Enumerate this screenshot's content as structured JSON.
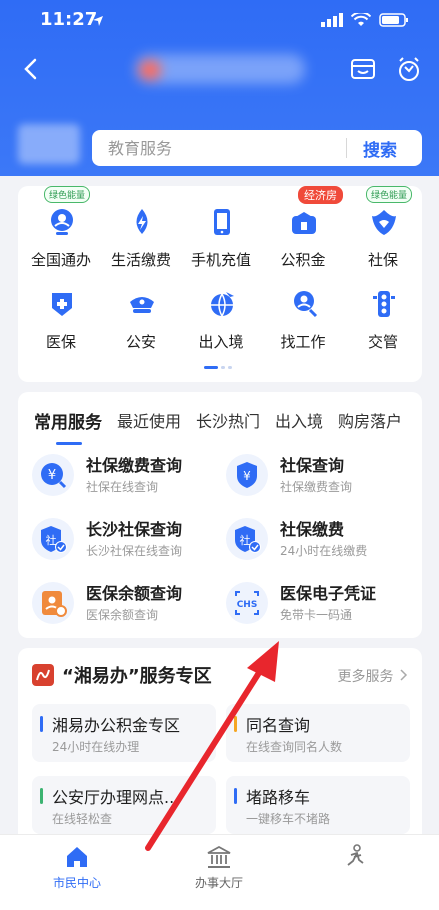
{
  "status_bar": {
    "time": "11:27"
  },
  "search": {
    "placeholder": "教育服务",
    "button_label": "搜索"
  },
  "quick_grid": {
    "items": [
      {
        "label": "全国通办",
        "badge": "绿色能量",
        "badge_type": "green",
        "icon": "globe-service-icon"
      },
      {
        "label": "生活缴费",
        "badge": "",
        "icon": "utility-bolt-icon"
      },
      {
        "label": "手机充值",
        "badge": "",
        "icon": "phone-icon"
      },
      {
        "label": "公积金",
        "badge": "经济房",
        "badge_type": "red",
        "icon": "housing-fund-icon"
      },
      {
        "label": "社保",
        "badge": "绿色能量",
        "badge_type": "green",
        "icon": "social-security-icon"
      },
      {
        "label": "医保",
        "badge": "",
        "icon": "medical-insurance-icon"
      },
      {
        "label": "公安",
        "badge": "",
        "icon": "police-cap-icon"
      },
      {
        "label": "出入境",
        "badge": "",
        "icon": "airplane-globe-icon"
      },
      {
        "label": "找工作",
        "badge": "",
        "icon": "job-search-icon"
      },
      {
        "label": "交管",
        "badge": "",
        "icon": "traffic-light-icon"
      }
    ]
  },
  "services": {
    "tabs": [
      "常用服务",
      "最近使用",
      "长沙热门",
      "出入境",
      "购房落户"
    ],
    "active_tab": 0,
    "items": [
      {
        "title": "社保缴费查询",
        "subtitle": "社保在线查询",
        "icon": "yuan-search-icon"
      },
      {
        "title": "社保查询",
        "subtitle": "社保缴费查询",
        "icon": "yuan-shield-icon"
      },
      {
        "title": "长沙社保查询",
        "subtitle": "长沙社保在线查询",
        "icon": "shield-check-icon"
      },
      {
        "title": "社保缴费",
        "subtitle": "24小时在线缴费",
        "icon": "shield-check-icon"
      },
      {
        "title": "医保余额查询",
        "subtitle": "医保余额查询",
        "icon": "medical-balance-icon"
      },
      {
        "title": "医保电子凭证",
        "subtitle": "免带卡一码通",
        "icon": "chs-code-icon"
      }
    ]
  },
  "zone": {
    "title": "“湘易办”服务专区",
    "more_label": "更多服务",
    "tiles": [
      {
        "title": "湘易办公积金专区",
        "subtitle": "24小时在线办理",
        "accent": "#2f6cf5"
      },
      {
        "title": "同名查询",
        "subtitle": "在线查询同名人数",
        "accent": "#f5a623"
      },
      {
        "title": "公安厅办理网点...",
        "subtitle": "在线轻松查",
        "accent": "#3cb371"
      },
      {
        "title": "堵路移车",
        "subtitle": "一键移车不堵路",
        "accent": "#2f6cf5"
      }
    ]
  },
  "bottom_nav": {
    "items": [
      {
        "label": "市民中心",
        "icon": "home-icon",
        "active": true
      },
      {
        "label": "办事大厅",
        "icon": "government-hall-icon",
        "active": false
      },
      {
        "label": "",
        "icon": "person-run-icon",
        "active": false
      }
    ]
  },
  "colors": {
    "primary": "#2f6cf5",
    "annotation_arrow": "#e8262d"
  }
}
